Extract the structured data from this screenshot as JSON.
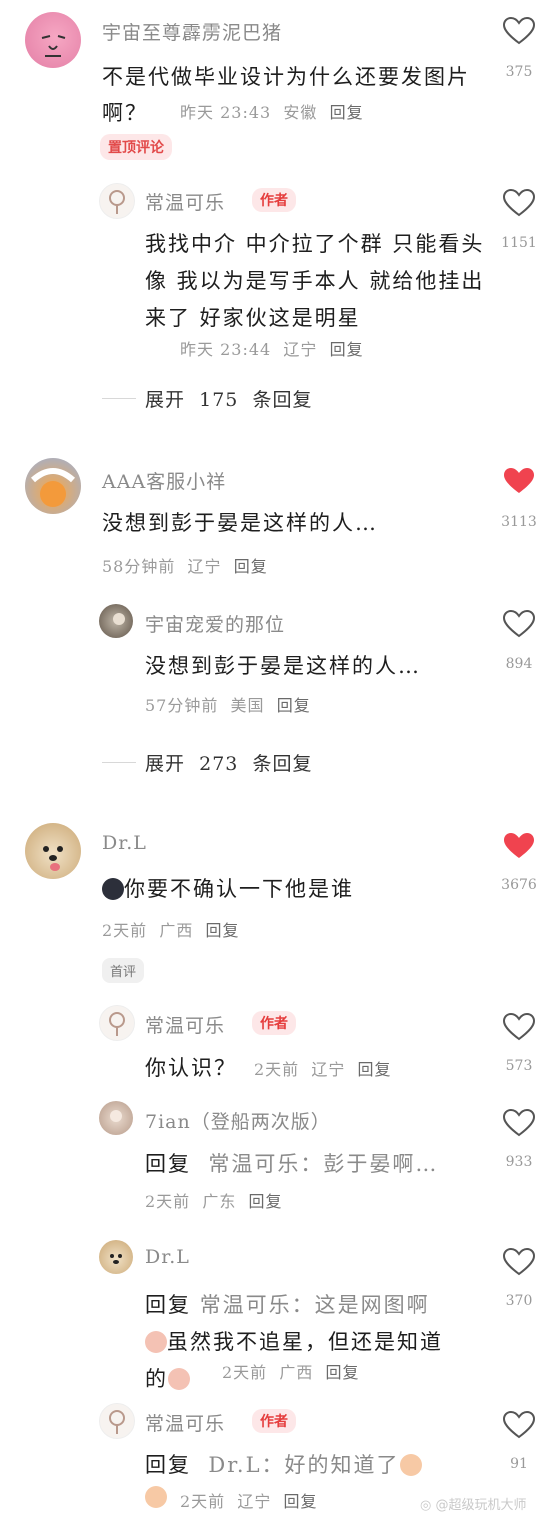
{
  "comments": [
    {
      "user": "宇宙至尊霹雳泥巴猪",
      "text": "不是代做毕业设计为什么还要发图片啊？",
      "time": "昨天 23:43",
      "location": "安徽",
      "reply": "回复",
      "tag": "置顶评论",
      "likes": "375",
      "liked": false,
      "replies": [
        {
          "user": "常温可乐",
          "badge": "作者",
          "text": "我找中介 中介拉了个群 只能看头像 我以为是写手本人 就给他挂出来了 好家伙这是明星",
          "time": "昨天 23:44",
          "location": "辽宁",
          "reply": "回复",
          "likes": "1151"
        }
      ],
      "expand": {
        "label": "展开",
        "count": "175",
        "suffix": "条回复"
      }
    },
    {
      "user": "AAA客服小祥",
      "text": "没想到彭于晏是这样的人…",
      "time": "58分钟前",
      "location": "辽宁",
      "reply": "回复",
      "likes": "3113",
      "liked": true,
      "replies": [
        {
          "user": "宇宙宠爱的那位",
          "text": "没想到彭于晏是这样的人…",
          "time": "57分钟前",
          "location": "美国",
          "reply": "回复",
          "likes": "894"
        }
      ],
      "expand": {
        "label": "展开",
        "count": "273",
        "suffix": "条回复"
      }
    },
    {
      "user": "Dr.L",
      "text": "你要不确认一下他是谁",
      "time": "2天前",
      "location": "广西",
      "reply": "回复",
      "tag": "首评",
      "likes": "3676",
      "liked": true,
      "replies": [
        {
          "user": "常温可乐",
          "badge": "作者",
          "text": "你认识？",
          "time": "2天前",
          "location": "辽宁",
          "reply": "回复",
          "likes": "573"
        },
        {
          "user": "7ian（登船两次版）",
          "text_prefix": "回复",
          "text_target": "常温可乐：彭于晏啊…",
          "time": "2天前",
          "location": "广东",
          "reply": "回复",
          "likes": "933"
        },
        {
          "user": "Dr.L",
          "text_prefix": "回复",
          "text_target": "常温可乐：这是网图啊",
          "text_line2": "虽然我不追星，但还是知道",
          "text_line3": "的",
          "time": "2天前",
          "location": "广西",
          "reply": "回复",
          "likes": "370"
        },
        {
          "user": "常温可乐",
          "badge": "作者",
          "text_prefix": "回复",
          "text_target": "Dr.L：好的知道了",
          "time": "2天前",
          "location": "辽宁",
          "reply": "回复",
          "likes": "91"
        }
      ]
    }
  ],
  "watermark": "@超级玩机大师",
  "colors": {
    "heart_red": "#f0434f",
    "author_tag_bg": "#fde7e8",
    "author_tag_fg": "#e53d3d"
  }
}
